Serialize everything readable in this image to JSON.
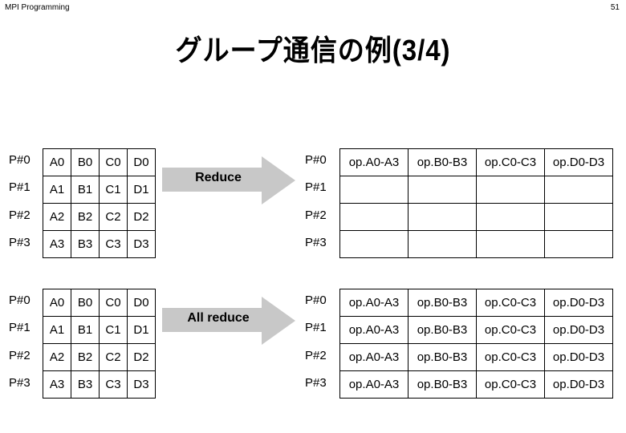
{
  "header": {
    "left": "MPI Programming",
    "page_number": "51"
  },
  "title": "グループ通信の例(3/4)",
  "arrow_color": "#c8c8c8",
  "sections": [
    {
      "name": "reduce",
      "arrow_label": "Reduce",
      "left": {
        "process_labels": [
          "P#0",
          "P#1",
          "P#2",
          "P#3"
        ],
        "rows": [
          [
            "A0",
            "B0",
            "C0",
            "D0"
          ],
          [
            "A1",
            "B1",
            "C1",
            "D1"
          ],
          [
            "A2",
            "B2",
            "C2",
            "D2"
          ],
          [
            "A3",
            "B3",
            "C3",
            "D3"
          ]
        ]
      },
      "right": {
        "process_labels": [
          "P#0",
          "P#1",
          "P#2",
          "P#3"
        ],
        "rows": [
          [
            "op.A0-A3",
            "op.B0-B3",
            "op.C0-C3",
            "op.D0-D3"
          ],
          [
            "",
            "",
            "",
            ""
          ],
          [
            "",
            "",
            "",
            ""
          ],
          [
            "",
            "",
            "",
            ""
          ]
        ]
      }
    },
    {
      "name": "allreduce",
      "arrow_label": "All reduce",
      "left": {
        "process_labels": [
          "P#0",
          "P#1",
          "P#2",
          "P#3"
        ],
        "rows": [
          [
            "A0",
            "B0",
            "C0",
            "D0"
          ],
          [
            "A1",
            "B1",
            "C1",
            "D1"
          ],
          [
            "A2",
            "B2",
            "C2",
            "D2"
          ],
          [
            "A3",
            "B3",
            "C3",
            "D3"
          ]
        ]
      },
      "right": {
        "process_labels": [
          "P#0",
          "P#1",
          "P#2",
          "P#3"
        ],
        "rows": [
          [
            "op.A0-A3",
            "op.B0-B3",
            "op.C0-C3",
            "op.D0-D3"
          ],
          [
            "op.A0-A3",
            "op.B0-B3",
            "op.C0-C3",
            "op.D0-D3"
          ],
          [
            "op.A0-A3",
            "op.B0-B3",
            "op.C0-C3",
            "op.D0-D3"
          ],
          [
            "op.A0-A3",
            "op.B0-B3",
            "op.C0-C3",
            "op.D0-D3"
          ]
        ]
      }
    }
  ]
}
